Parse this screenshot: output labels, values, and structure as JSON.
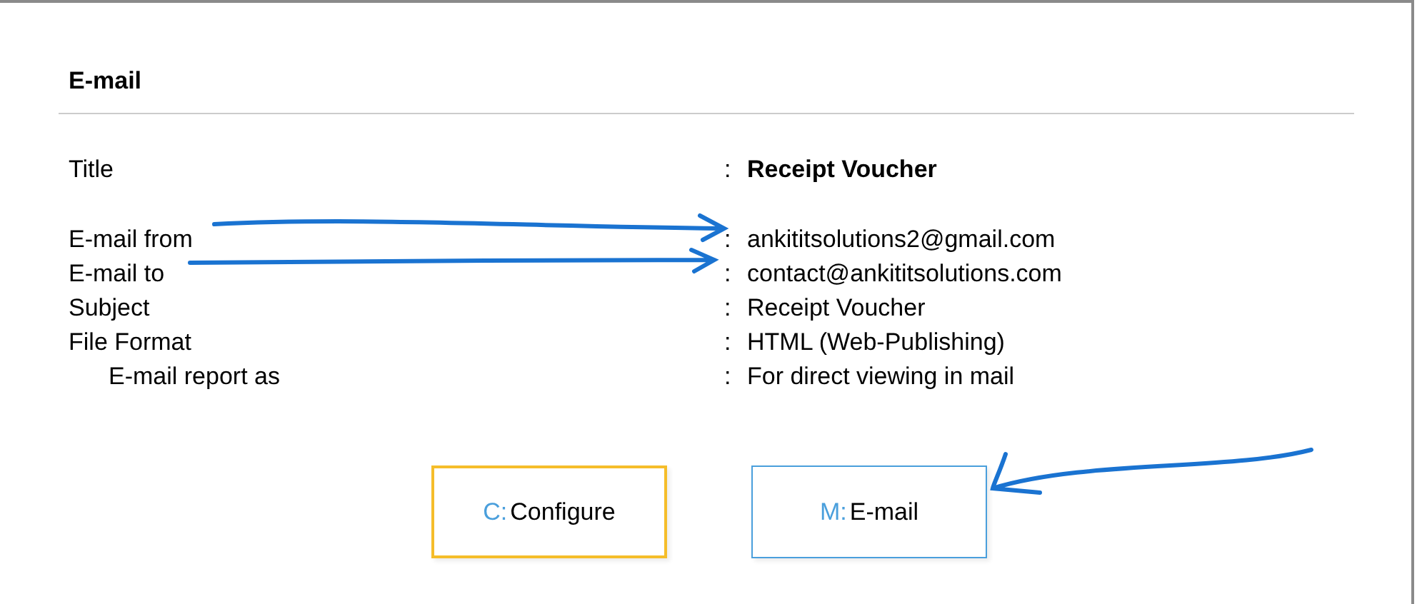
{
  "section": {
    "title": "E-mail"
  },
  "rows": [
    {
      "label": "Title",
      "separator": ":",
      "value": "Receipt Voucher",
      "kind": "title"
    },
    {
      "label": "E-mail from",
      "separator": ":",
      "value": "ankititsolutions2@gmail.com",
      "kind": "field"
    },
    {
      "label": "E-mail to",
      "separator": ":",
      "value": "contact@ankititsolutions.com",
      "kind": "field"
    },
    {
      "label": "Subject",
      "separator": ":",
      "value": "Receipt Voucher",
      "kind": "field"
    },
    {
      "label": "File Format",
      "separator": ":",
      "value": "HTML (Web-Publishing)",
      "kind": "field",
      "children": [
        {
          "label": "E-mail report as",
          "separator": ":",
          "value": "For direct viewing in mail"
        }
      ]
    }
  ],
  "buttons": [
    {
      "key": "C:",
      "label": "Configure",
      "selected": true
    },
    {
      "key": "M:",
      "label": "E-mail",
      "selected": false
    }
  ]
}
